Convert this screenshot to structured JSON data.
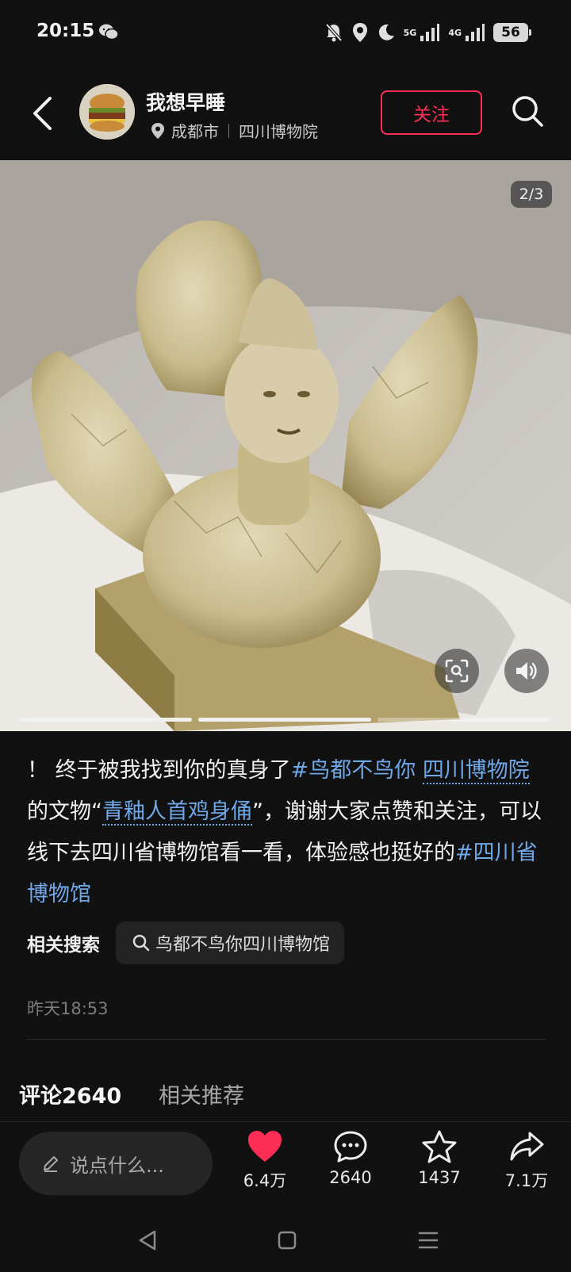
{
  "status_bar": {
    "time": "20:15",
    "network_1": "5G",
    "network_2": "4G",
    "battery": "56"
  },
  "header": {
    "author_name": "我想早睡",
    "city": "成都市",
    "place": "四川博物院",
    "follow_label": "关注"
  },
  "photo": {
    "page_indicator": "2/3",
    "page_current": 2,
    "page_total": 3
  },
  "caption": {
    "lead": "！ 终于被我找到你的真身了",
    "tag_1": "#鸟都不鸟你",
    "linked_place": "四川博物院",
    "text_1": " 的文物“",
    "relic_name": "青釉人首鸡身俑",
    "text_2": "”，谢谢大家点赞和关注，可以线下去四川省博物馆看一看，体验感也挺好的",
    "tag_2": "#四川省博物馆"
  },
  "related_search": {
    "label": "相关搜索",
    "query": "鸟都不鸟你四川博物馆"
  },
  "post_time": "昨天18:53",
  "tabs": {
    "comments": "评论2640",
    "recommend": "相关推荐"
  },
  "bottom_bar": {
    "input_placeholder": "说点什么...",
    "likes": "6.4万",
    "comments": "2640",
    "favorites": "1437",
    "shares": "7.1万",
    "liked": true,
    "like_color": "#ff2d55"
  }
}
